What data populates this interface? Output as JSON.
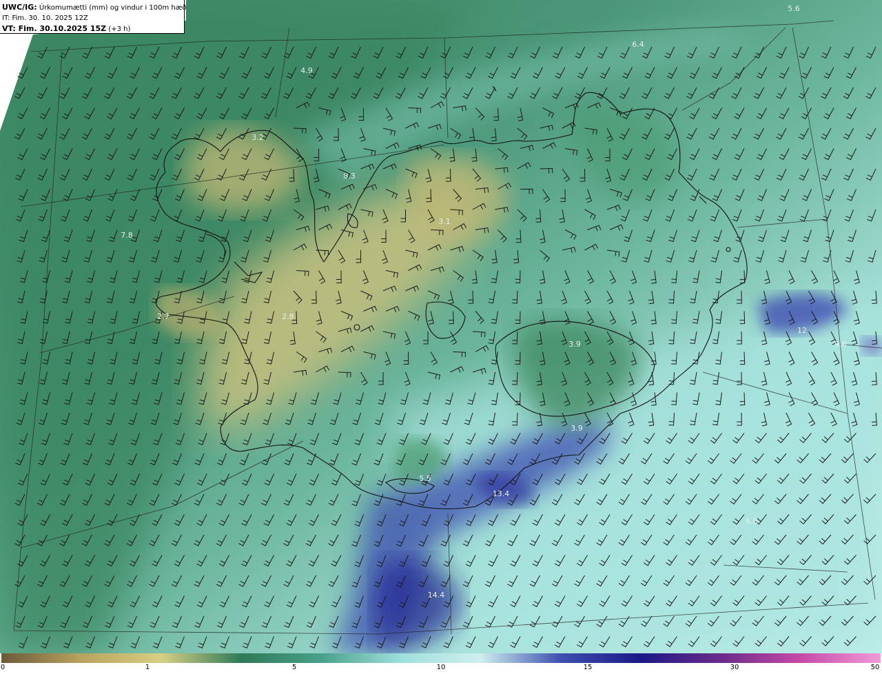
{
  "header": {
    "model": "UWC/IG:",
    "title": "Úrkomumætti (mm) og vindur i 100m hæð",
    "it_label": "IT: Fim. 30. 10. 2025 12Z",
    "vt_label": "VT: Fim. 30.10.2025 15Z",
    "vt_offset": "(+3 h)"
  },
  "legend": {
    "ticks": [
      "0",
      "1",
      "5",
      "10",
      "15",
      "30",
      "50"
    ],
    "colors": [
      "#6b5a3a",
      "#b8a35e",
      "#d7cf84",
      "#2f7a58",
      "#4aa08a",
      "#9fe0dc",
      "#cfeeee",
      "#3f4fb0",
      "#1c1a86",
      "#6a2a8a",
      "#c64aa8",
      "#f09ad8"
    ]
  },
  "max_labels": [
    "5.6",
    "6.4",
    "4.9",
    "3.2",
    "8.3",
    "7.8",
    "3.1",
    "2.7",
    "2.8",
    "3.9",
    "12",
    "9.8",
    "3.9",
    "5.5",
    "13.4",
    "14.4",
    "6.8"
  ]
}
